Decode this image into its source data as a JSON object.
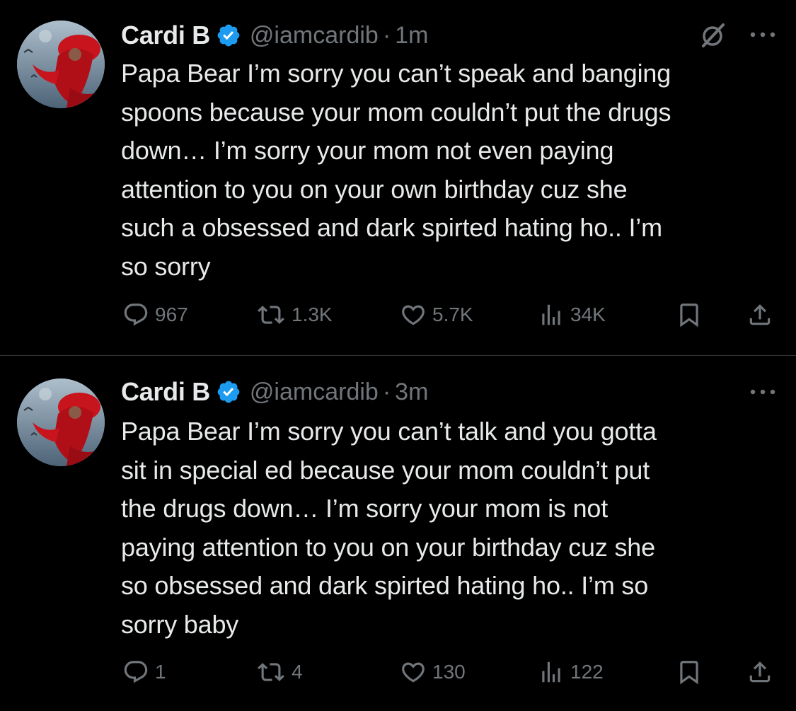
{
  "colors": {
    "background": "#000000",
    "text_primary": "#e7e9ea",
    "text_secondary": "#71767b",
    "verified_badge": "#1d9bf0",
    "divider": "#2f3336"
  },
  "tweets": [
    {
      "display_name": "Cardi B",
      "handle": "@iamcardib",
      "separator": "·",
      "time": "1m",
      "text": "Papa Bear I’m sorry you can’t speak and banging\nspoons because your mom couldn’t put the drugs\ndown… I’m sorry your mom not even paying\nattention to you on your own birthday cuz she\nsuch a obsessed and dark spirted hating ho.. I’m\nso sorry",
      "replies": "967",
      "reposts": "1.3K",
      "likes": "5.7K",
      "views": "34K",
      "icons": [
        "avatar",
        "verified-badge-icon",
        "grok-icon",
        "more-icon",
        "reply-icon",
        "retweet-icon",
        "like-icon",
        "views-icon",
        "bookmark-icon",
        "share-icon"
      ]
    },
    {
      "display_name": "Cardi B",
      "handle": "@iamcardib",
      "separator": "·",
      "time": "3m",
      "text": "Papa Bear I’m sorry you can’t talk and you gotta\nsit in special ed because your mom couldn’t put\nthe drugs down… I’m sorry your mom is not\npaying attention to you on your birthday cuz she\nso obsessed and dark spirted hating ho.. I’m so\nsorry baby",
      "replies": "1",
      "reposts": "4",
      "likes": "130",
      "views": "122",
      "icons": [
        "avatar",
        "verified-badge-icon",
        "more-icon",
        "reply-icon",
        "retweet-icon",
        "like-icon",
        "views-icon",
        "bookmark-icon",
        "share-icon"
      ]
    }
  ]
}
